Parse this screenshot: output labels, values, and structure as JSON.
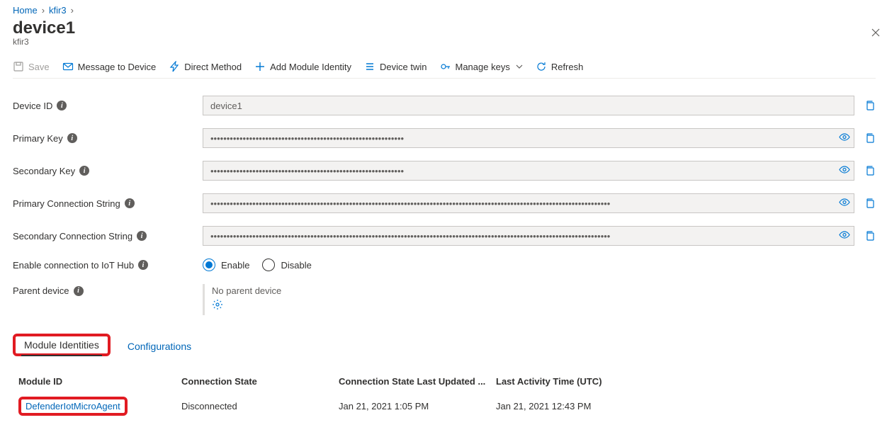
{
  "breadcrumb": {
    "home": "Home",
    "hub": "kfir3"
  },
  "header": {
    "title": "device1",
    "subtitle": "kfir3"
  },
  "toolbar": {
    "save": "Save",
    "message": "Message to Device",
    "direct_method": "Direct Method",
    "add_module": "Add Module Identity",
    "device_twin": "Device twin",
    "manage_keys": "Manage keys",
    "refresh": "Refresh"
  },
  "form": {
    "labels": {
      "device_id": "Device ID",
      "primary_key": "Primary Key",
      "secondary_key": "Secondary Key",
      "primary_cs": "Primary Connection String",
      "secondary_cs": "Secondary Connection String",
      "enable_conn": "Enable connection to IoT Hub",
      "parent": "Parent device"
    },
    "device_id": "device1",
    "primary_key_mask": "••••••••••••••••••••••••••••••••••••••••••••••••••••••••••••",
    "secondary_key_mask": "••••••••••••••••••••••••••••••••••••••••••••••••••••••••••••",
    "primary_cs_mask": "••••••••••••••••••••••••••••••••••••••••••••••••••••••••••••••••••••••••••••••••••••••••••••••••••••••••••••••••••••••••••••",
    "secondary_cs_mask": "••••••••••••••••••••••••••••••••••••••••••••••••••••••••••••••••••••••••••••••••••••••••••••••••••••••••••••••••••••••••••••",
    "enable_option": "Enable",
    "disable_option": "Disable",
    "no_parent": "No parent device"
  },
  "tabs": {
    "modules": "Module Identities",
    "configs": "Configurations"
  },
  "table": {
    "headers": {
      "module_id": "Module ID",
      "conn_state": "Connection State",
      "conn_updated": "Connection State Last Updated ...",
      "last_activity": "Last Activity Time (UTC)"
    },
    "rows": [
      {
        "module_id": "DefenderIotMicroAgent",
        "conn_state": "Disconnected",
        "conn_updated": "Jan 21, 2021 1:05 PM",
        "last_activity": "Jan 21, 2021 12:43 PM"
      }
    ]
  }
}
